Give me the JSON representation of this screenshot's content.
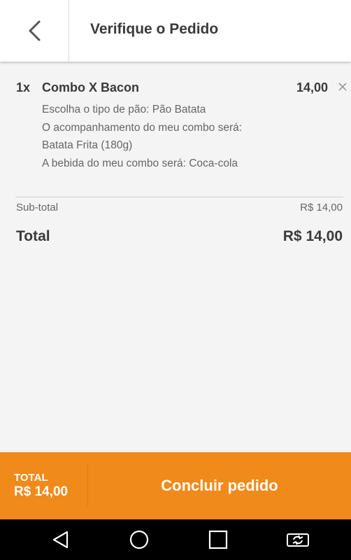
{
  "header": {
    "title": "Verifique o Pedido"
  },
  "order": {
    "items": [
      {
        "qty": "1x",
        "name": "Combo X Bacon",
        "price": "14,00",
        "options": [
          "Escolha o tipo de pão: Pão Batata",
          "O acompanhamento do meu combo será:",
          "Batata Frita (180g)",
          "A bebida do meu combo será: Coca-cola"
        ]
      }
    ],
    "subtotal_label": "Sub-total",
    "subtotal_value": "R$ 14,00",
    "total_label": "Total",
    "total_value": "R$ 14,00"
  },
  "footer": {
    "total_label": "TOTAL",
    "total_value": "R$ 14,00",
    "conclude_label": "Concluir pedido"
  },
  "colors": {
    "accent": "#f08a1a",
    "background": "#f4f4f4",
    "text": "#3a3a3a"
  },
  "icons": [
    "chevron-left-icon",
    "close-icon",
    "nav-back-icon",
    "nav-home-icon",
    "nav-recents-icon",
    "screen-rotate-icon"
  ]
}
